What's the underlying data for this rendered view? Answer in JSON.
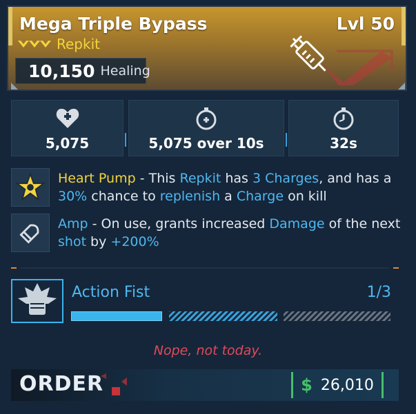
{
  "item": {
    "name": "Mega Triple Bypass",
    "level": "Lvl 50",
    "rarity": "Repkit",
    "healing_value": "10,150",
    "healing_label": "Healing",
    "icon": "syringe-icon",
    "rarity_color": "#f4d43c"
  },
  "stats": [
    {
      "icon": "heart-health-icon",
      "value": "5,075"
    },
    {
      "icon": "regen-timer-icon",
      "value": "5,075 over 10s"
    },
    {
      "icon": "cooldown-stopwatch-icon",
      "value": "32s"
    }
  ],
  "perks": [
    {
      "icon": "heart-pump-star-icon",
      "name": "Heart Pump",
      "sep": " - ",
      "t1": "This ",
      "k1": "Repkit",
      "t2": " has ",
      "k2": "3 Charges",
      "t3": ", and has a ",
      "k3": "30%",
      "t4": " chance to ",
      "k4": "replenish",
      "t5": " a ",
      "k5": "Charge",
      "t6": " on kill"
    },
    {
      "icon": "amp-bullet-icon",
      "name": "Amp",
      "sep": " - ",
      "t1": "On use, grants increased ",
      "k1": "Damage",
      "t2": " of the next ",
      "k2": "shot",
      "t3": " by ",
      "k3": "+200%"
    }
  ],
  "ability": {
    "icon": "action-fist-icon",
    "name": "Action Fist",
    "count": "1/3",
    "progress_filled": 1,
    "progress_total": 3
  },
  "flavor_text": "Nope, not today.",
  "manufacturer": {
    "logo_text": "ORDER",
    "currency_icon": "dollar-icon",
    "currency_symbol": "$",
    "price": "26,010"
  },
  "colors": {
    "accent_blue": "#4fb8f0",
    "accent_yellow": "#f4d43c",
    "flavor_red": "#e04a5a",
    "money_green": "#46c06a"
  }
}
